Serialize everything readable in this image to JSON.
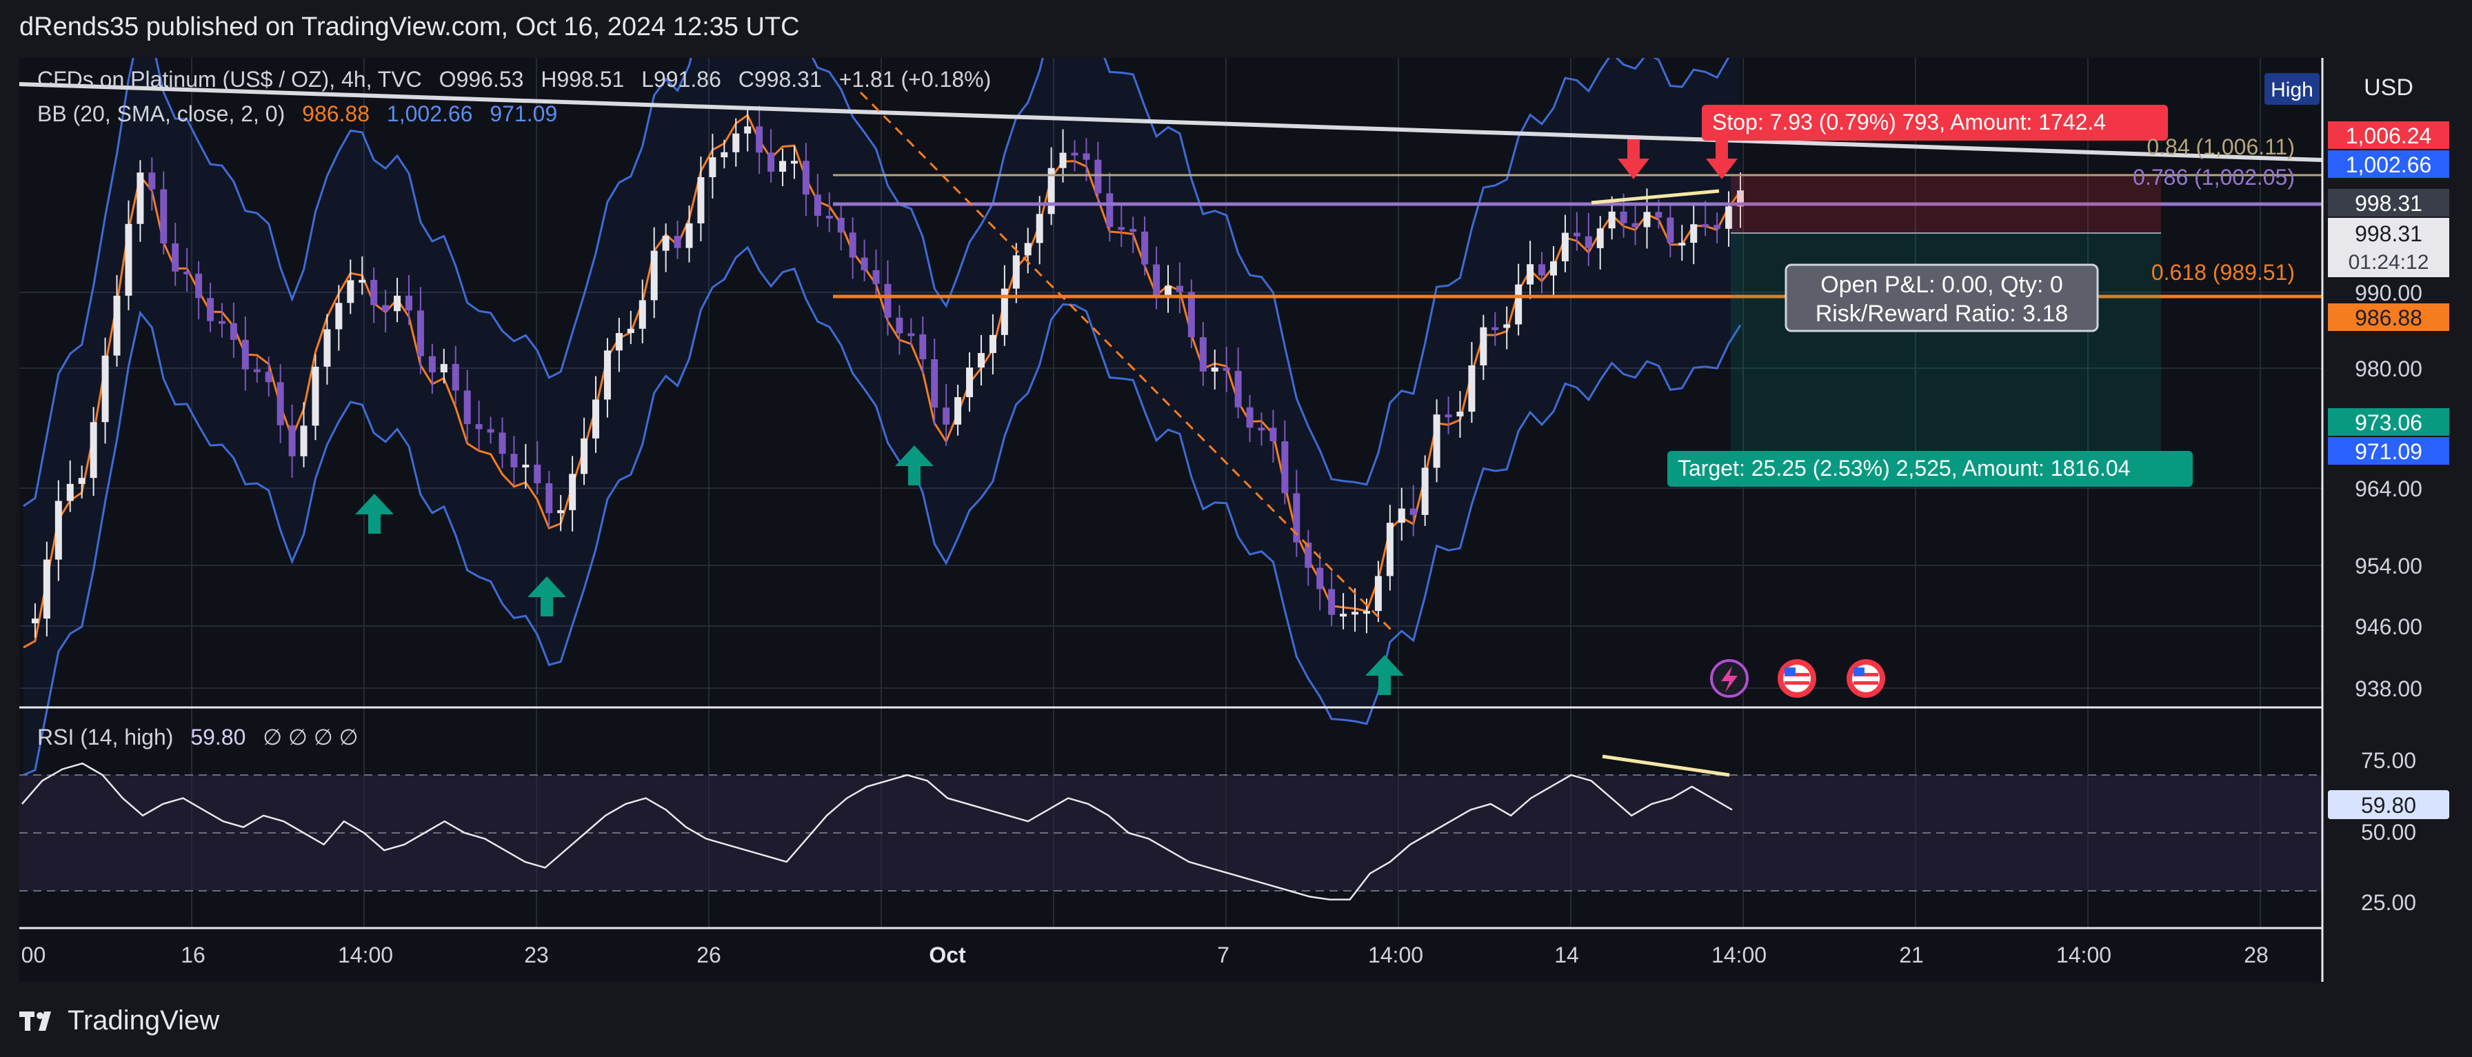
{
  "header": {
    "publisher_line": "dRends35 published on TradingView.com, Oct 16, 2024 12:35 UTC"
  },
  "footer": {
    "brand_name": "TradingView",
    "brand_icon": "tradingview-logo-icon"
  },
  "chart_data": {
    "type": "candlestick",
    "instrument": {
      "title": "CFDs on Platinum (US$ / OZ), 4h, TVC",
      "open": "O996.53",
      "high": "H998.51",
      "low": "L991.86",
      "close": "C998.31",
      "change": "+1.81 (+0.18%)"
    },
    "indicator_bb": {
      "label": "BB (20, SMA, close, 2, 0)",
      "basis": "986.88",
      "upper": "1,002.66",
      "lower": "971.09",
      "colors": {
        "basis": "#f7931a",
        "bands": "#3d6bd6"
      }
    },
    "currency": "USD",
    "high_badge": "High",
    "price_axis_ticks": [
      "990.00",
      "980.00",
      "964.00",
      "954.00",
      "946.00",
      "938.00"
    ],
    "price_badges": [
      {
        "text": "1,006.24",
        "color": "#f23645"
      },
      {
        "text": "1,002.66",
        "color": "#2962ff"
      },
      {
        "text": "998.31",
        "color": "#3a3e4a"
      },
      {
        "text": "998.31",
        "color": "#e8e8ec"
      },
      {
        "text": "01:24:12",
        "color": "#e8e8ec"
      },
      {
        "text": "986.88",
        "color": "#f57c1f"
      },
      {
        "text": "973.06",
        "color": "#089981"
      },
      {
        "text": "971.09",
        "color": "#2962ff"
      }
    ],
    "fib_levels": [
      {
        "label": "0.84 (1,006.11)",
        "color": "#b5a67d"
      },
      {
        "label": "0.786 (1,002.05)",
        "color": "#9575cd"
      },
      {
        "label": "0.618 (989.51)",
        "color": "#f57c1f"
      }
    ],
    "position_tool": {
      "stop_label": "Stop: 7.93 (0.79%) 793, Amount: 1742.4",
      "target_label": "Target: 25.25 (2.53%) 2,525, Amount: 1816.04",
      "pnl_label": "Open P&L: 0.00, Qty: 0",
      "rr_label": "Risk/Reward Ratio: 3.18"
    },
    "x_axis_labels": [
      ":00",
      "16",
      "14:00",
      "23",
      "26",
      "Oct",
      "7",
      "14:00",
      "14",
      "14:00",
      "21",
      "14:00",
      "28"
    ],
    "rsi": {
      "label": "RSI (14, high)",
      "value": "59.80",
      "extras": "∅ ∅ ∅ ∅",
      "ticks": [
        "75.00",
        "50.00",
        "25.00"
      ],
      "values": [
        60,
        68,
        72,
        74,
        70,
        62,
        56,
        60,
        62,
        58,
        54,
        52,
        56,
        54,
        50,
        46,
        54,
        50,
        44,
        46,
        50,
        54,
        50,
        48,
        44,
        40,
        38,
        44,
        50,
        56,
        60,
        62,
        58,
        52,
        48,
        46,
        44,
        42,
        40,
        48,
        56,
        62,
        66,
        68,
        70,
        68,
        62,
        60,
        58,
        56,
        54,
        58,
        62,
        60,
        56,
        50,
        48,
        44,
        40,
        38,
        36,
        34,
        32,
        30,
        28,
        27,
        27,
        36,
        40,
        46,
        50,
        54,
        58,
        60,
        56,
        62,
        66,
        70,
        68,
        62,
        56,
        60,
        62,
        66,
        62,
        58
      ]
    },
    "markers": [
      "up-arrow-icon",
      "down-arrow-icon",
      "flash-icon",
      "us-flag-icon"
    ]
  }
}
